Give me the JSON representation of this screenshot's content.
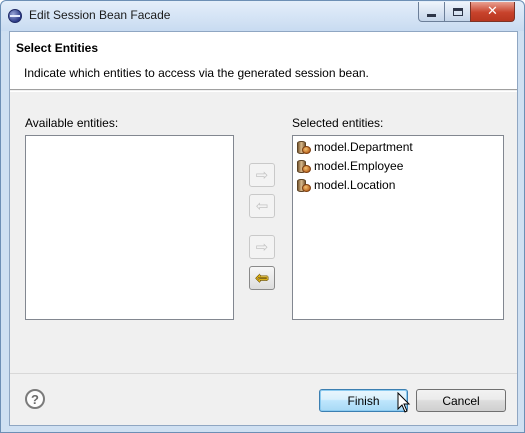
{
  "window": {
    "title": "Edit Session Bean Facade",
    "controls": {
      "minimize": "minimize",
      "maximize": "maximize",
      "close": "✕"
    }
  },
  "header": {
    "title": "Select Entities",
    "description": "Indicate which entities to access via the generated session bean."
  },
  "available": {
    "label": "Available entities:",
    "items": []
  },
  "selected": {
    "label": "Selected entities:",
    "items": [
      {
        "label": "model.Department",
        "icon": "entity-bean-icon"
      },
      {
        "label": "model.Employee",
        "icon": "entity-bean-icon"
      },
      {
        "label": "model.Location",
        "icon": "entity-bean-icon"
      }
    ]
  },
  "transfer_buttons": [
    {
      "name": "add-button",
      "glyph": "⇨",
      "enabled": false
    },
    {
      "name": "remove-button",
      "glyph": "⇦",
      "enabled": false
    },
    {
      "name": "add-all-button",
      "glyph": "⇨",
      "enabled": false
    },
    {
      "name": "remove-all-button",
      "glyph": "⇦",
      "enabled": true
    }
  ],
  "footer": {
    "help": "?",
    "finish": "Finish",
    "cancel": "Cancel"
  },
  "colors": {
    "accent": "#3c7fb1",
    "enabled_arrow": "#f4c41c"
  }
}
